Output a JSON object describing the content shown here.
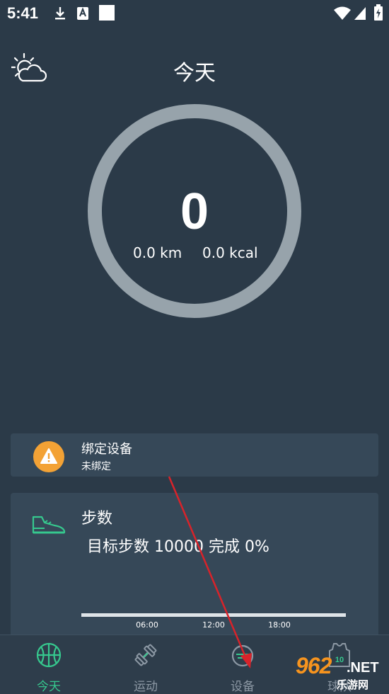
{
  "status_bar": {
    "time": "5:41"
  },
  "header": {
    "title": "今天"
  },
  "summary": {
    "steps": "0",
    "distance": "0.0 km",
    "calories": "0.0 kcal",
    "goal_progress": 0
  },
  "bind_card": {
    "title": "绑定设备",
    "subtitle": "未绑定"
  },
  "steps_card": {
    "title": "步数",
    "goal_text": "目标步数 10000 完成 0%",
    "time_ticks": [
      "06:00",
      "12:00",
      "18:00"
    ]
  },
  "nav": {
    "items": [
      {
        "label": "今天",
        "active": true
      },
      {
        "label": "运动",
        "active": false
      },
      {
        "label": "设备",
        "active": false
      },
      {
        "label": "球队",
        "active": false
      }
    ]
  },
  "watermark": {
    "number": "962",
    "domain": ".NET",
    "sub": "乐游网"
  },
  "colors": {
    "background": "#2b3a48",
    "card": "#364858",
    "ring": "#97a3ab",
    "accent": "#36c88e",
    "warning": "#f3a235",
    "inactive": "#8c98a4"
  }
}
